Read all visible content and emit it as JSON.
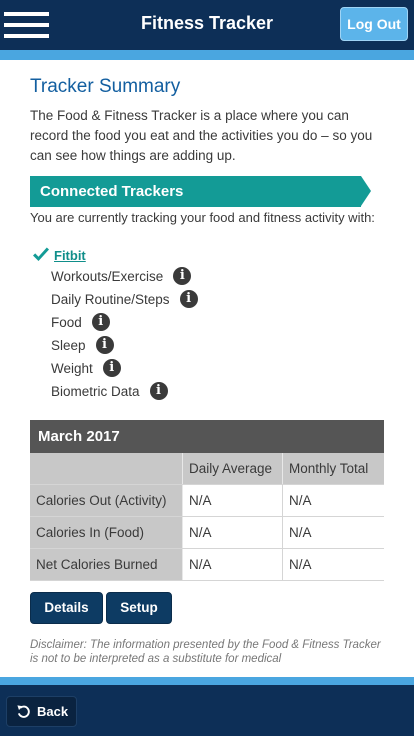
{
  "header": {
    "title": "Fitness Tracker",
    "logout_label": "Log Out"
  },
  "summary": {
    "title": "Tracker Summary",
    "intro": "The Food & Fitness Tracker is a place where you can record the food you eat and the activities you do – so you can see how things are adding up."
  },
  "connected": {
    "banner": "Connected Trackers",
    "tracking_text": "You are currently tracking your food and fitness activity with:",
    "device_link": "Fitbit",
    "features": [
      {
        "label": "Workouts/Exercise",
        "icon": "info-icon"
      },
      {
        "label": "Daily Routine/Steps",
        "icon": "info-icon"
      },
      {
        "label": "Food",
        "icon": "info-icon"
      },
      {
        "label": "Sleep",
        "icon": "info-icon"
      },
      {
        "label": "Weight",
        "icon": "info-icon"
      },
      {
        "label": "Biometric Data",
        "icon": "info-icon"
      }
    ]
  },
  "table": {
    "period": "March 2017",
    "columns": [
      "",
      "Daily Average",
      "Monthly Total"
    ],
    "rows": [
      {
        "label": "Calories Out (Activity)",
        "daily": "N/A",
        "monthly": "N/A"
      },
      {
        "label": "Calories In (Food)",
        "daily": "N/A",
        "monthly": "N/A"
      },
      {
        "label": "Net Calories Burned",
        "daily": "N/A",
        "monthly": "N/A"
      }
    ]
  },
  "actions": {
    "details_label": "Details",
    "setup_label": "Setup"
  },
  "disclaimer": "Disclaimer: The information presented by the Food & Fitness Tracker is not to be interpreted as a substitute for medical",
  "footer": {
    "back_label": "Back"
  },
  "colors": {
    "header_bg": "#0d2f57",
    "accent_blue": "#4aa6e0",
    "teal": "#139b96",
    "title_blue": "#135fa0",
    "table_head": "#555555"
  }
}
